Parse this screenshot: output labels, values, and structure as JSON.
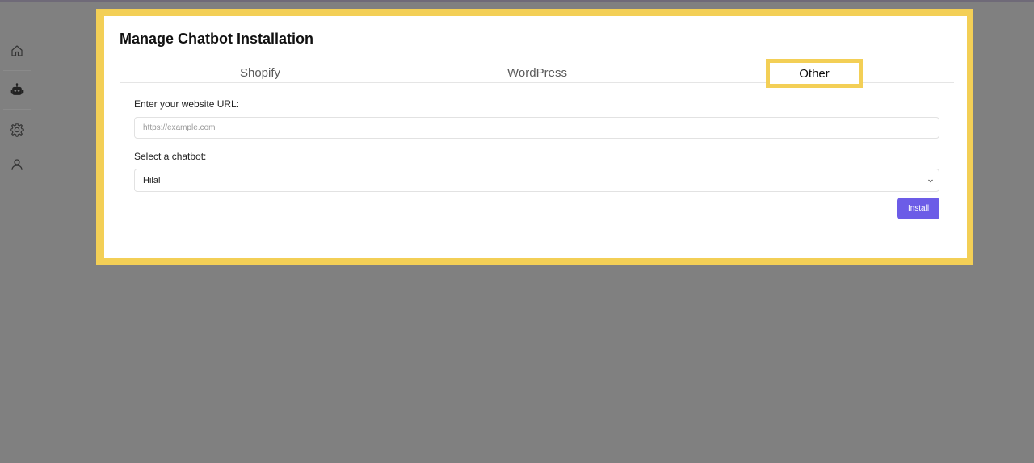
{
  "page": {
    "title": "Manage Chatbot Installation"
  },
  "sidebar": {
    "items": [
      {
        "name": "home",
        "icon": "home-icon"
      },
      {
        "name": "chatbots",
        "icon": "robot-icon"
      },
      {
        "name": "settings",
        "icon": "gear-icon"
      },
      {
        "name": "profile",
        "icon": "user-icon"
      }
    ]
  },
  "tabs": [
    {
      "label": "Shopify"
    },
    {
      "label": "WordPress"
    },
    {
      "label": "Other",
      "active": true
    }
  ],
  "form": {
    "url_label": "Enter your website URL:",
    "url_placeholder": "https://example.com",
    "url_value": "",
    "chatbot_label": "Select a chatbot:",
    "chatbot_selected": "Hilal",
    "install_label": "Install"
  },
  "colors": {
    "accent": "#6c5ce7",
    "highlight": "#f3cf56",
    "backdrop": "#808080"
  }
}
